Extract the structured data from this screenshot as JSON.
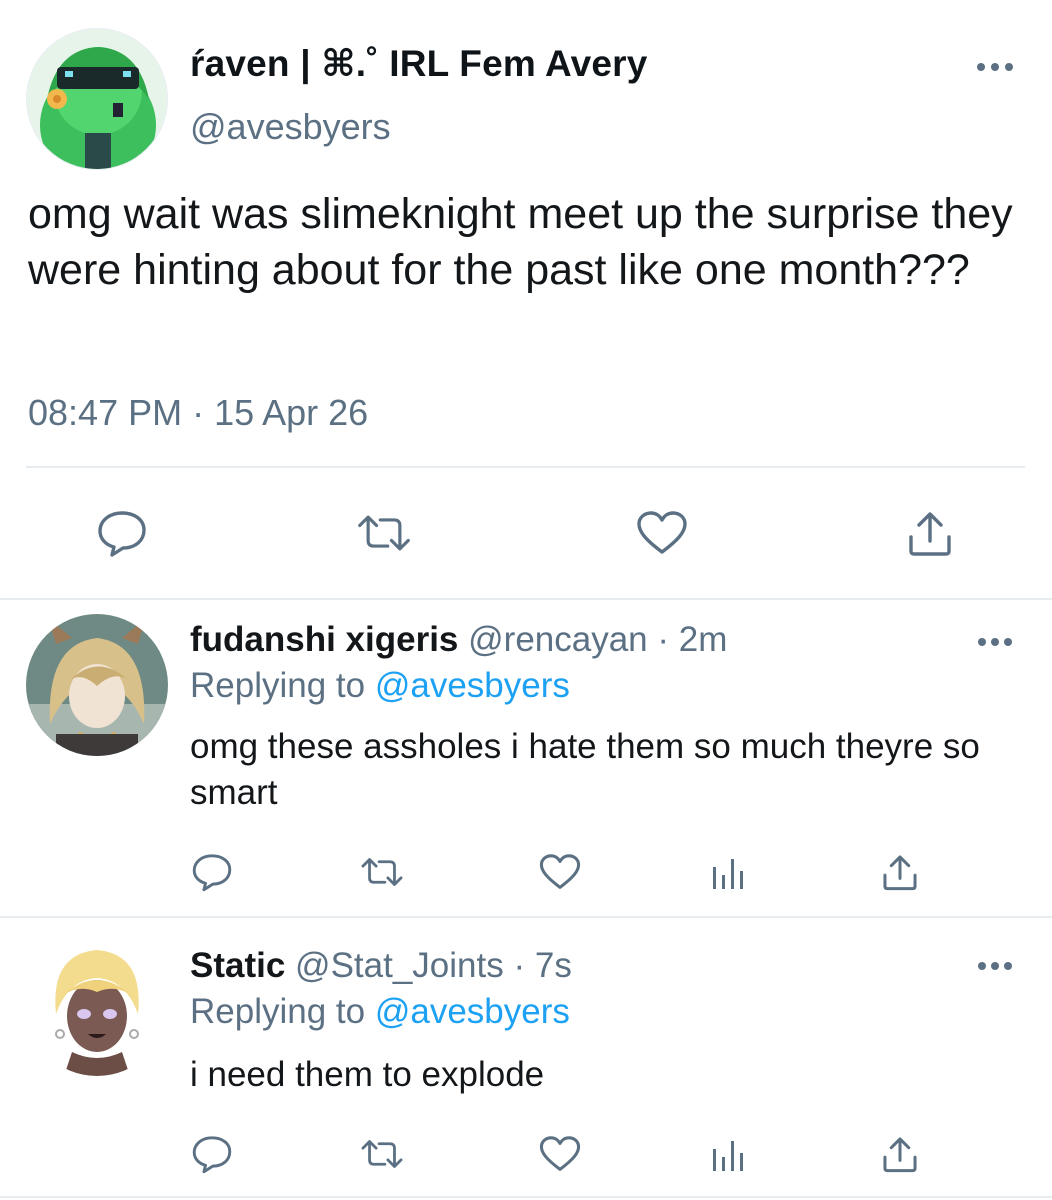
{
  "main_tweet": {
    "display_name": "ŕaven | ⌘.˚ IRL Fem Avery",
    "handle": "@avesbyers",
    "text": "omg wait was slimeknight meet up the surprise they were hinting about for the past like one month???",
    "timestamp": "08:47 PM · 15 Apr 26",
    "avatar_icon": "avatar-green-character",
    "actions": [
      "reply-icon",
      "retweet-icon",
      "like-icon",
      "share-icon"
    ]
  },
  "replies": [
    {
      "display_name": "fudanshi xigeris",
      "handle": "@rencayan",
      "time": "· 2m",
      "replying_prefix": "Replying to ",
      "replying_to": "@avesbyers",
      "text": "omg these assholes i hate them so much theyre so smart",
      "avatar_icon": "avatar-blonde-horned-character",
      "actions": [
        "reply-icon",
        "retweet-icon",
        "like-icon",
        "analytics-icon",
        "share-icon"
      ]
    },
    {
      "display_name": "Static",
      "handle": "@Stat_Joints",
      "time": "· 7s",
      "replying_prefix": "Replying to ",
      "replying_to": "@avesbyers",
      "text": "i need them to explode",
      "avatar_icon": "avatar-dark-skinned-character",
      "actions": [
        "reply-icon",
        "retweet-icon",
        "like-icon",
        "analytics-icon",
        "share-icon"
      ]
    }
  ],
  "colors": {
    "text_primary": "#14171a",
    "text_secondary": "#5b7083",
    "accent": "#1da1f2",
    "divider": "#e6ecf0"
  }
}
